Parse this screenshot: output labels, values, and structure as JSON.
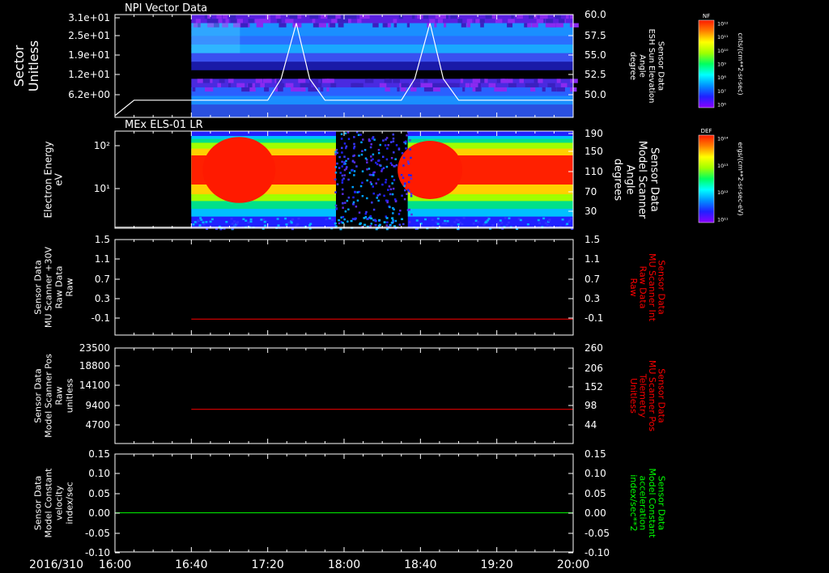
{
  "colors": {
    "background": "#000000",
    "frame": "#ffffff",
    "text": "#ffffff",
    "red_trace": "#ff0000",
    "green_trace": "#00ff00",
    "white_trace": "#ffffff"
  },
  "time_axis": {
    "date_label": "2016/310",
    "ticks": [
      "16:00",
      "16:40",
      "17:20",
      "18:00",
      "18:40",
      "19:20",
      "20:00"
    ]
  },
  "colorbars": [
    {
      "title": "NF",
      "unit_label": "cnts/(cm**2-sr-sec)",
      "tick_labels": [
        "10¹²",
        "10¹¹",
        "10¹⁰",
        "10⁹",
        "10⁸",
        "10⁷",
        "10⁶"
      ]
    },
    {
      "title": "DEF",
      "unit_label": "ergs/(cm**2-sr-sec-eV)",
      "tick_labels": [
        "10¹⁴",
        "10¹³",
        "10¹²",
        "10¹¹"
      ]
    }
  ],
  "panels": [
    {
      "title": "NPI Vector Data",
      "left_label": [
        "Sector",
        "Unitless"
      ],
      "left_ticks": [
        "3.1e+01",
        "2.5e+01",
        "1.9e+01",
        "1.2e+01",
        "6.2e+00"
      ],
      "right_label": [
        "Sensor Data",
        "ESH Sun Elevation",
        "Angle",
        "degree"
      ],
      "right_ticks": [
        "60.0",
        "57.5",
        "55.0",
        "52.5",
        "50.0"
      ],
      "right_label_color": "#ffffff"
    },
    {
      "title": "MEx ELS-01 LR",
      "left_label": [
        "Electron Energy",
        "eV"
      ],
      "left_ticks": [
        "10²",
        "10¹"
      ],
      "right_label": [
        "Sensor Data",
        "Model Scanner",
        "Angle",
        "degrees"
      ],
      "right_ticks": [
        "190",
        "150",
        "110",
        "70",
        "30"
      ],
      "right_label_color": "#ffffff"
    },
    {
      "title": "",
      "left_label": [
        "Sensor Data",
        "MU Scanner +30V",
        "Raw Data",
        "Raw"
      ],
      "left_ticks": [
        "1.5",
        "1.1",
        "0.7",
        "0.3",
        "-0.1"
      ],
      "right_label": [
        "Sensor Data",
        "MU Scanner Int",
        "Raw Data",
        "Raw"
      ],
      "right_ticks": [
        "1.5",
        "1.1",
        "0.7",
        "0.3",
        "-0.1"
      ],
      "right_label_color": "#ff0000"
    },
    {
      "title": "",
      "left_label": [
        "Sensor Data",
        "Model Scanner Pos",
        "Raw",
        "unitless"
      ],
      "left_ticks": [
        "23500",
        "18800",
        "14100",
        "9400",
        "4700"
      ],
      "right_label": [
        "Sensor Data",
        "MU Scanner Pos",
        "Telemetry",
        "Unitless"
      ],
      "right_ticks": [
        "260",
        "206",
        "152",
        "98",
        "44"
      ],
      "right_label_color": "#ff0000"
    },
    {
      "title": "",
      "left_label": [
        "Sensor Data",
        "Model Constant",
        "velocity",
        "index/sec"
      ],
      "left_ticks": [
        "0.15",
        "0.10",
        "0.05",
        "0.00",
        "-0.05",
        "-0.10"
      ],
      "right_label": [
        "Sensor Data",
        "Model Constant",
        "acceleration",
        "index/sec**2"
      ],
      "right_ticks": [
        "0.15",
        "0.10",
        "0.05",
        "0.00",
        "-0.05",
        "-0.10"
      ],
      "right_label_color": "#00ff00"
    }
  ],
  "chart_data": [
    {
      "type": "heatmap",
      "title": "NPI Vector Data",
      "ylabel": "Sector Unitless",
      "ylim": [
        0,
        31
      ],
      "y2label": "Sensor Data ESH Sun Elevation Angle degree",
      "y2lim": [
        48.0,
        60.0
      ],
      "x_range": [
        "16:00",
        "20:00"
      ],
      "data_start": "16:40",
      "overlay_line": {
        "name": "ESH Sun Elevation Angle",
        "x": [
          "16:00",
          "16:10",
          "16:40",
          "17:20",
          "17:27",
          "17:35",
          "17:42",
          "17:50",
          "18:00",
          "18:20",
          "18:30",
          "18:37",
          "18:45",
          "18:52",
          "19:00",
          "20:00"
        ],
        "y": [
          48.2,
          50.0,
          50.0,
          50.0,
          52.5,
          59.0,
          52.5,
          50.0,
          50.0,
          50.0,
          50.0,
          52.5,
          59.0,
          52.5,
          50.0,
          50.0
        ]
      }
    },
    {
      "type": "heatmap",
      "title": "MEx ELS-01 LR",
      "ylabel": "Electron Energy eV",
      "yscale": "log",
      "ylim": [
        1,
        200
      ],
      "y2label": "Sensor Data Model Scanner Angle degrees",
      "y2lim": [
        10,
        190
      ],
      "x_range": [
        "16:00",
        "20:00"
      ],
      "data_start": "16:40",
      "data_gap": [
        "18:00",
        "18:30"
      ],
      "overlay_line": {
        "name": "Model Scanner Angle",
        "x": [
          "16:00",
          "20:00"
        ],
        "y": [
          12,
          12
        ]
      }
    },
    {
      "type": "line",
      "ylabel": "Sensor Data MU Scanner +30V Raw Data Raw",
      "y2label": "Sensor Data MU Scanner Int Raw Data Raw",
      "ylim": [
        -0.3,
        1.5
      ],
      "series": [
        {
          "name": "MU Scanner Int Raw Data",
          "color": "#ff0000",
          "x": [
            "16:40",
            "20:00"
          ],
          "y": [
            0.0,
            0.0
          ]
        }
      ]
    },
    {
      "type": "line",
      "ylabel": "Sensor Data Model Scanner Pos Raw unitless",
      "y2label": "Sensor Data MU Scanner Pos Telemetry Unitless",
      "ylim": [
        0,
        23500
      ],
      "y2lim": [
        -10,
        260
      ],
      "series": [
        {
          "name": "MU Scanner Pos Telemetry",
          "color": "#ff0000",
          "x": [
            "16:40",
            "20:00"
          ],
          "y": [
            8400,
            8400
          ]
        }
      ]
    },
    {
      "type": "line",
      "ylabel": "Sensor Data Model Constant velocity index/sec",
      "y2label": "Sensor Data Model Constant acceleration index/sec**2",
      "ylim": [
        -0.1,
        0.15
      ],
      "series": [
        {
          "name": "Model Constant acceleration",
          "color": "#00ff00",
          "x": [
            "16:00",
            "20:00"
          ],
          "y": [
            0.0,
            0.0
          ]
        }
      ]
    }
  ]
}
